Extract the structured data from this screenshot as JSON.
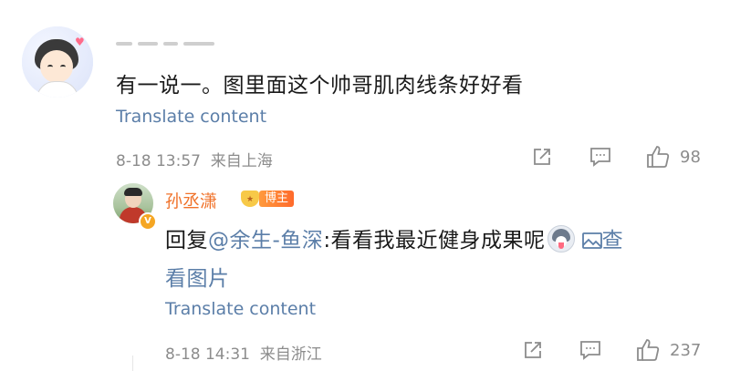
{
  "main_comment": {
    "text": "有一说一。图里面这个帅哥肌肉线条好好看",
    "translate": "Translate content",
    "time": "8-18 13:57",
    "location": "来自上海",
    "likes": "98"
  },
  "reply": {
    "username": "孙丞潇",
    "badge": "博主",
    "prefix": "回复",
    "mention": "@余生-鱼深",
    "text": ":看看我最近健身成果呢",
    "view_image_part1": "查",
    "view_image_part2": "看图片",
    "translate": "Translate content",
    "time": "8-18 14:31",
    "location": "来自浙江",
    "likes": "237"
  },
  "icons": {
    "share": "share-icon",
    "comment": "comment-icon",
    "like": "thumbs-up-icon",
    "image": "image-icon",
    "emoji": "husky-emoji-icon"
  },
  "colors": {
    "link": "#5b7ea8",
    "meta": "#8c8c8c",
    "username": "#f0722a",
    "badge": "#ff7a2c"
  }
}
